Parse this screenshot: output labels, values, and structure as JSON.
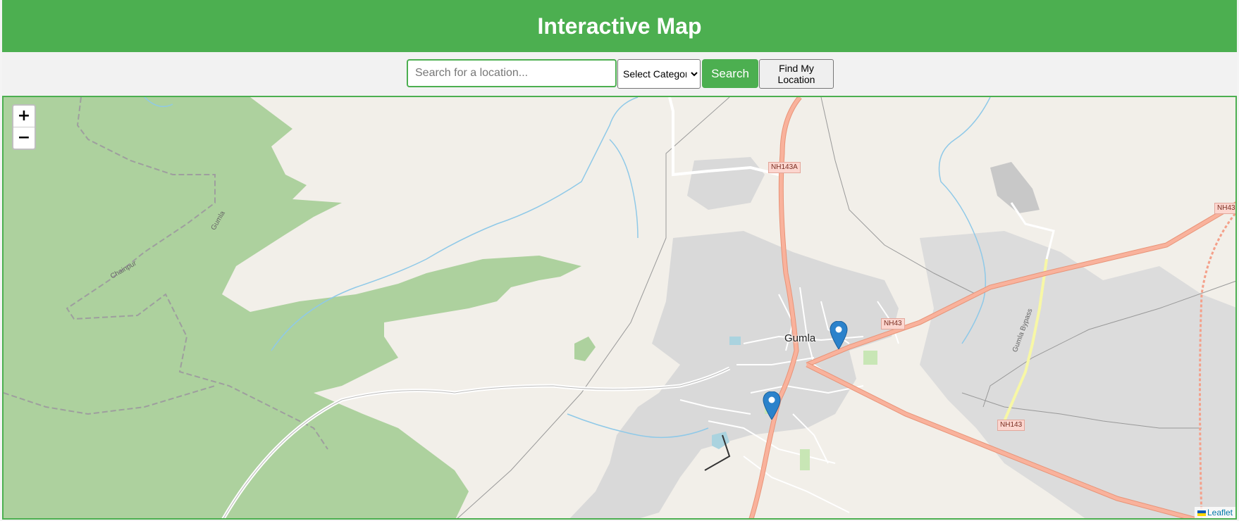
{
  "header": {
    "title": "Interactive Map"
  },
  "controls": {
    "search_placeholder": "Search for a location...",
    "category_selected": "Select Category",
    "search_label": "Search",
    "locate_label": "Find My Location"
  },
  "map": {
    "zoom_in": "+",
    "zoom_out": "−",
    "attribution": "Leaflet",
    "labels": {
      "town": "Gumla",
      "nh143a": "NH143A",
      "nh43_east": "NH43",
      "nh43_center": "NH43",
      "nh143": "NH143",
      "bypass": "Gumla Bypass",
      "chainpur": "Chainpur",
      "gumla_small": "Gumla"
    },
    "markers": [
      "marker-north",
      "marker-south"
    ],
    "colors": {
      "forest": "#add19e",
      "land": "#f2efe9",
      "urban": "#d9d9d9",
      "trunk_road": "#f5a58b",
      "water": "#8fc9e8",
      "marker": "#2b82cb"
    }
  }
}
